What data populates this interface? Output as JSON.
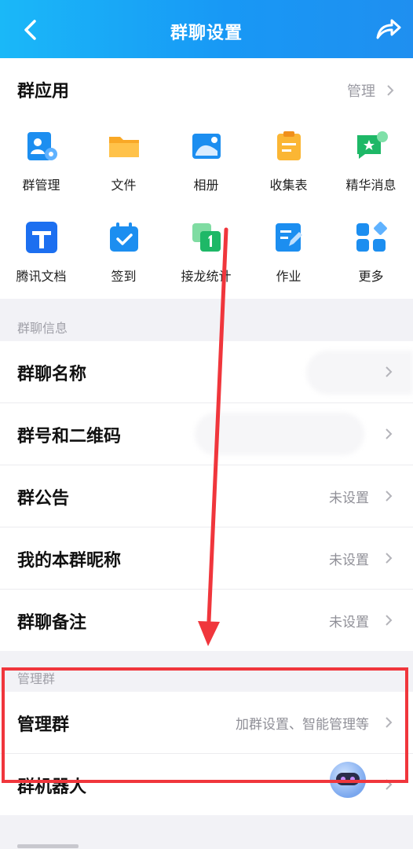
{
  "header": {
    "title": "群聊设置",
    "back_icon": "back-chevron-icon",
    "share_icon": "share-icon"
  },
  "apps": {
    "title": "群应用",
    "manage_label": "管理",
    "items": [
      {
        "label": "群管理",
        "icon": "group-manage-icon"
      },
      {
        "label": "文件",
        "icon": "folder-icon"
      },
      {
        "label": "相册",
        "icon": "album-icon"
      },
      {
        "label": "收集表",
        "icon": "collect-form-icon"
      },
      {
        "label": "精华消息",
        "icon": "featured-message-icon"
      },
      {
        "label": "腾讯文档",
        "icon": "tencent-docs-icon"
      },
      {
        "label": "签到",
        "icon": "check-in-icon"
      },
      {
        "label": "接龙统计",
        "icon": "relay-stats-icon"
      },
      {
        "label": "作业",
        "icon": "homework-icon"
      },
      {
        "label": "更多",
        "icon": "more-apps-icon"
      }
    ]
  },
  "info": {
    "section_title": "群聊信息",
    "rows": [
      {
        "label": "群聊名称",
        "value": ""
      },
      {
        "label": "群号和二维码",
        "value": ""
      },
      {
        "label": "群公告",
        "value": "未设置"
      },
      {
        "label": "我的本群昵称",
        "value": "未设置"
      },
      {
        "label": "群聊备注",
        "value": "未设置"
      }
    ]
  },
  "admin": {
    "section_title": "管理群",
    "rows": [
      {
        "label": "管理群",
        "value": "加群设置、智能管理等"
      },
      {
        "label": "群机器人",
        "value": ""
      }
    ]
  },
  "colors": {
    "header_start": "#1ab8f8",
    "header_end": "#1f8ff0",
    "annotation": "#f0363c"
  }
}
